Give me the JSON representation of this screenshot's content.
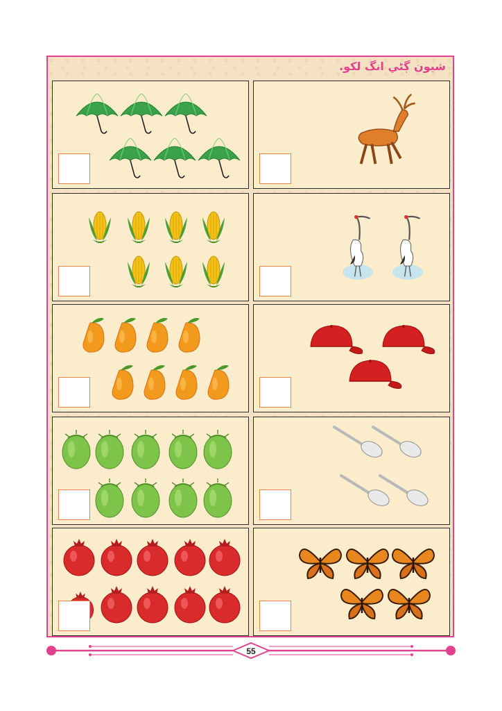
{
  "title": "شيون ڳڻي انگ لکو.",
  "page_number": "55",
  "colors": {
    "frame": "#e0428f",
    "panel": "#fbeccb",
    "box_border": "#e8834a"
  },
  "cells": [
    {
      "name": "umbrellas",
      "count": 6,
      "icon": "umbrella-icon"
    },
    {
      "name": "deer",
      "count": 1,
      "icon": "deer-icon"
    },
    {
      "name": "corn",
      "count": 7,
      "icon": "corn-icon"
    },
    {
      "name": "cranes",
      "count": 2,
      "icon": "crane-icon"
    },
    {
      "name": "mangoes",
      "count": 8,
      "icon": "mango-icon"
    },
    {
      "name": "caps",
      "count": 3,
      "icon": "cap-icon"
    },
    {
      "name": "coconuts",
      "count": 9,
      "icon": "coconut-icon"
    },
    {
      "name": "spoons",
      "count": 4,
      "icon": "spoon-icon"
    },
    {
      "name": "pomegranates",
      "count": 10,
      "icon": "pomegranate-icon"
    },
    {
      "name": "butterflies",
      "count": 5,
      "icon": "butterfly-icon"
    }
  ]
}
